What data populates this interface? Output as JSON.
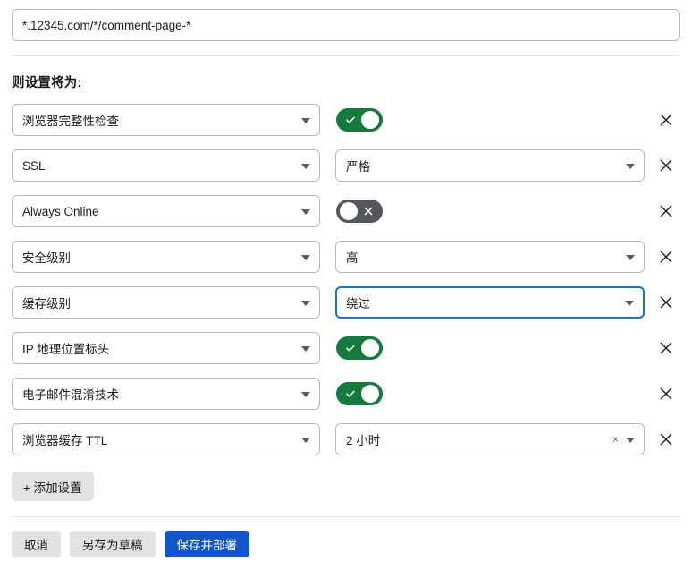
{
  "url_field": {
    "value": "*.12345.com/*/comment-page-*",
    "placeholder": "URL pattern"
  },
  "section": {
    "title": "则设置将为:"
  },
  "settings_rows": [
    {
      "setting": "浏览器完整性检查",
      "control": "toggle",
      "toggle_on": true,
      "remove_label": "×"
    },
    {
      "setting": "SSL",
      "control": "select",
      "value": "严格",
      "focused": false,
      "remove_label": "×"
    },
    {
      "setting": "Always Online",
      "control": "toggle",
      "toggle_on": false,
      "remove_label": "×"
    },
    {
      "setting": "安全级别",
      "control": "select",
      "value": "高",
      "focused": false,
      "remove_label": "×"
    },
    {
      "setting": "缓存级别",
      "control": "select",
      "value": "绕过",
      "focused": true,
      "remove_label": "×"
    },
    {
      "setting": "IP 地理位置标头",
      "control": "toggle",
      "toggle_on": true,
      "remove_label": "×"
    },
    {
      "setting": "电子邮件混淆技术",
      "control": "toggle",
      "toggle_on": true,
      "remove_label": "×"
    },
    {
      "setting": "浏览器缓存 TTL",
      "control": "select",
      "value": "2 小时",
      "focused": false,
      "clearable": true,
      "clear_label": "×",
      "remove_label": "×"
    }
  ],
  "add_button": {
    "label": "+ 添加设置"
  },
  "footer": {
    "cancel_label": "取消",
    "draft_label": "另存为草稿",
    "deploy_label": "保存并部署"
  },
  "colors": {
    "toggle_on": "#147a3d",
    "toggle_off": "#54585c",
    "primary_button": "#1155cc",
    "focus_border": "#1a73c8",
    "secondary_button": "#e2e2e2",
    "border": "#b8b8b8",
    "divider": "#e2e2e2"
  }
}
